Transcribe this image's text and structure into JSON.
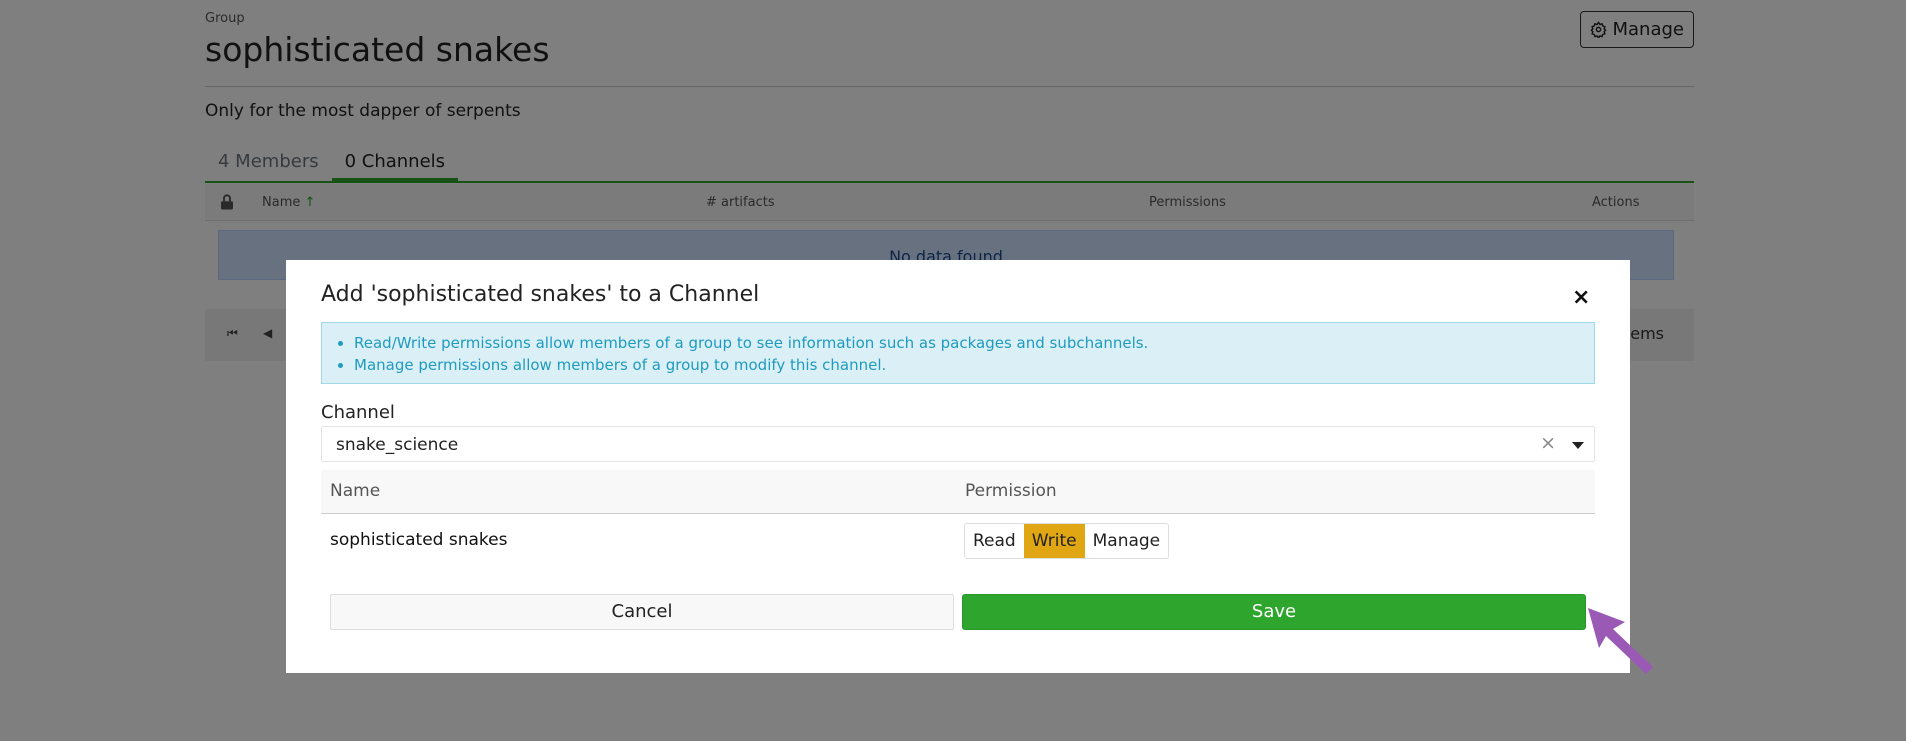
{
  "page": {
    "group_caption": "Group",
    "group_title": "sophisticated snakes",
    "manage_label": "Manage",
    "description": "Only for the most dapper of serpents",
    "tabs": [
      {
        "label": "4 Members",
        "active": false
      },
      {
        "label": "0 Channels",
        "active": true
      }
    ],
    "grid": {
      "columns": [
        "Name",
        "# artifacts",
        "Permissions",
        "Actions"
      ],
      "sort_indicator": "↑",
      "empty_text": "No data found",
      "pager_items_label": "items"
    }
  },
  "modal": {
    "title": "Add 'sophisticated snakes' to a Channel",
    "close_label": "×",
    "info": [
      "Read/Write permissions allow members of a group to see information such as packages and subchannels.",
      "Manage permissions allow members of a group to modify this channel."
    ],
    "channel_label": "Channel",
    "channel_value": "snake_science",
    "clear_label": "×",
    "table_headers": {
      "name": "Name",
      "permission": "Permission"
    },
    "row": {
      "name": "sophisticated snakes"
    },
    "permission_options": [
      {
        "label": "Read",
        "selected": false
      },
      {
        "label": "Write",
        "selected": true
      },
      {
        "label": "Manage",
        "selected": false
      }
    ],
    "cancel_label": "Cancel",
    "save_label": "Save"
  },
  "colors": {
    "primary_green": "#2ea52d",
    "selected_permission": "#e0a613",
    "info_text": "#1e9bbf",
    "pointer": "#9b59b6"
  },
  "icons": {
    "manage": "gear-icon",
    "lock": "lock-icon",
    "pointer": "arrow-pointer-icon"
  }
}
